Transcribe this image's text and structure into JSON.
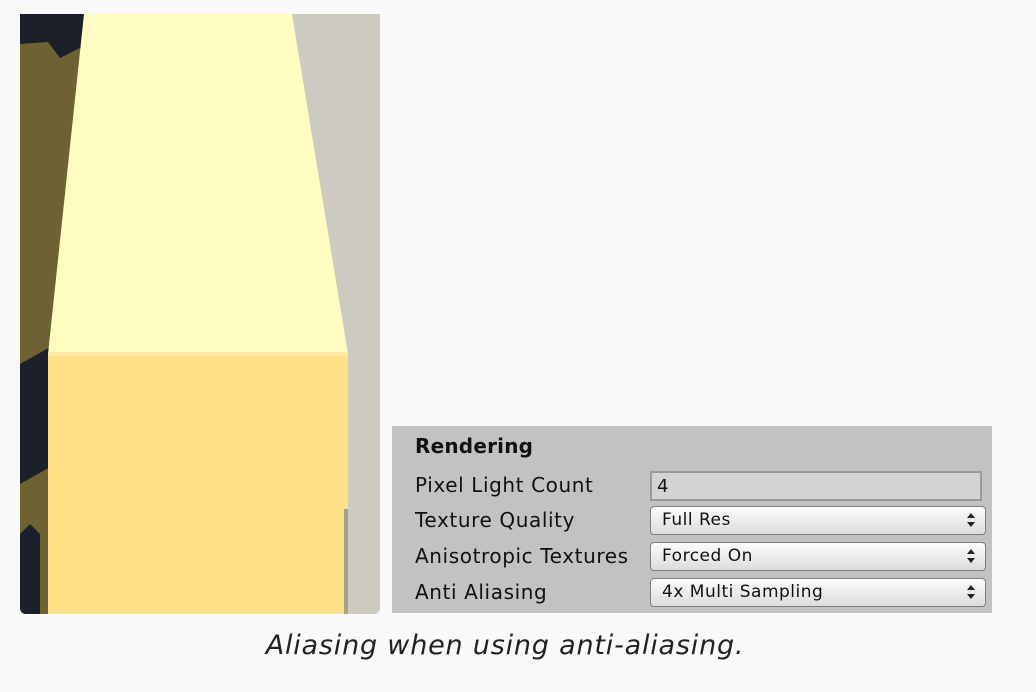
{
  "scene": {
    "colors": {
      "wall_dark": "#1b202a",
      "wall_olive": "#6e6134",
      "beam_light": "#fffcc2",
      "block_yellow": "#ffdf88",
      "background_grey": "#cdcbbf"
    }
  },
  "panel": {
    "title": "Rendering",
    "rows": [
      {
        "label": "Pixel Light Count",
        "type": "number",
        "value": "4"
      },
      {
        "label": "Texture Quality",
        "type": "select",
        "value": "Full Res"
      },
      {
        "label": "Anisotropic Textures",
        "type": "select",
        "value": "Forced On"
      },
      {
        "label": "Anti Aliasing",
        "type": "select",
        "value": "4x Multi Sampling"
      }
    ]
  },
  "caption": "Aliasing when using anti-aliasing."
}
